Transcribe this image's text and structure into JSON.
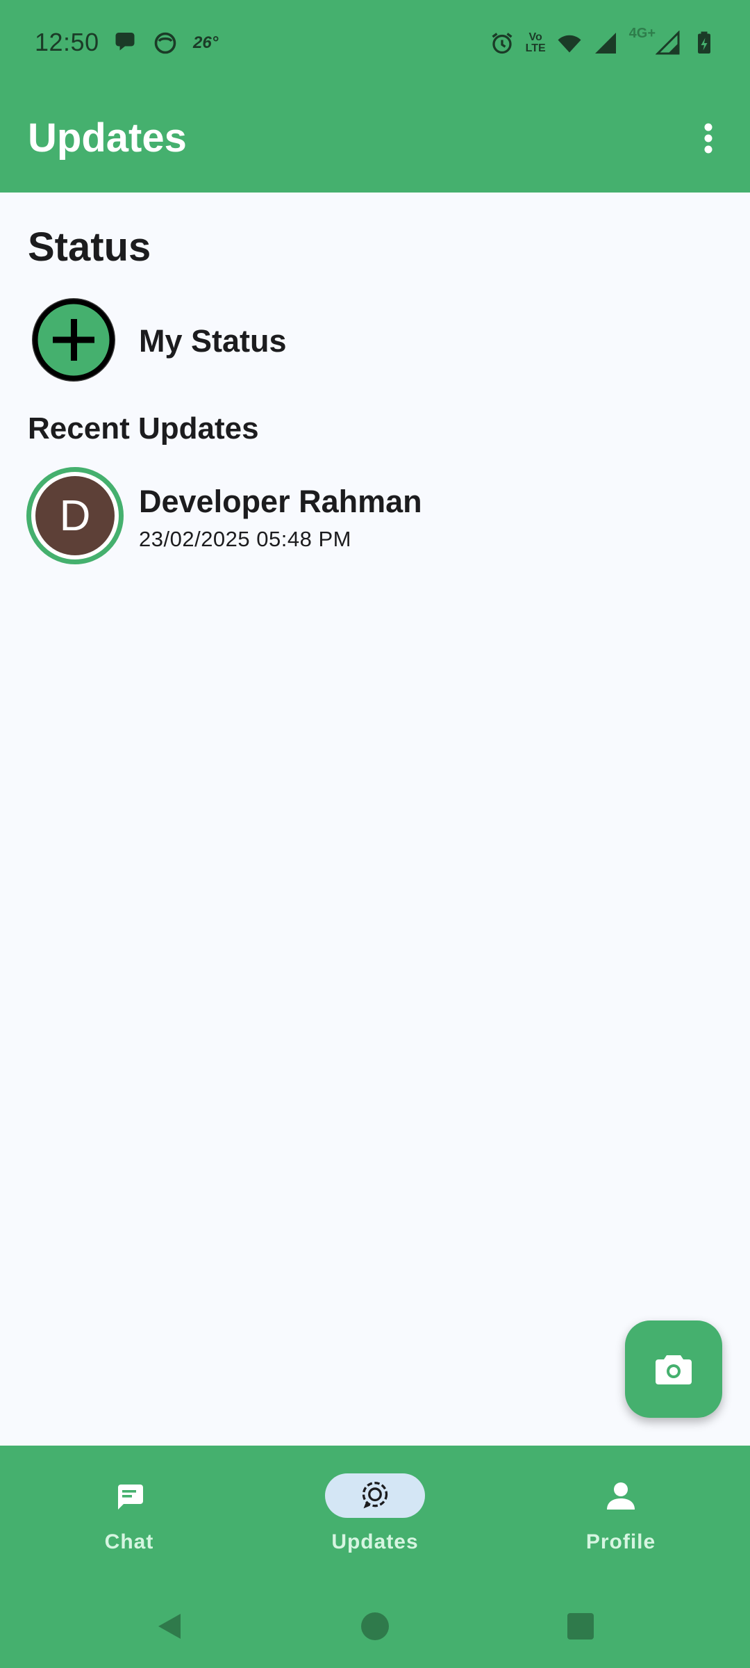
{
  "status_bar": {
    "time": "12:50",
    "temperature": "26°",
    "volte_top": "Vo",
    "volte_bottom": "LTE",
    "network": "4G+"
  },
  "app_bar": {
    "title": "Updates"
  },
  "status_section": {
    "title": "Status",
    "my_status_label": "My Status"
  },
  "recent_section": {
    "title": "Recent Updates",
    "items": [
      {
        "initial": "D",
        "name": "Developer Rahman",
        "timestamp": "23/02/2025 05:48 PM"
      }
    ]
  },
  "bottom_nav": {
    "items": [
      {
        "label": "Chat",
        "icon": "chat-icon"
      },
      {
        "label": "Updates",
        "icon": "updates-icon",
        "active": true
      },
      {
        "label": "Profile",
        "icon": "profile-icon"
      }
    ]
  },
  "colors": {
    "primary": "#45b06e",
    "background": "#f8fafe",
    "avatar": "#5d4037",
    "active_indicator": "#d4e6f5"
  }
}
